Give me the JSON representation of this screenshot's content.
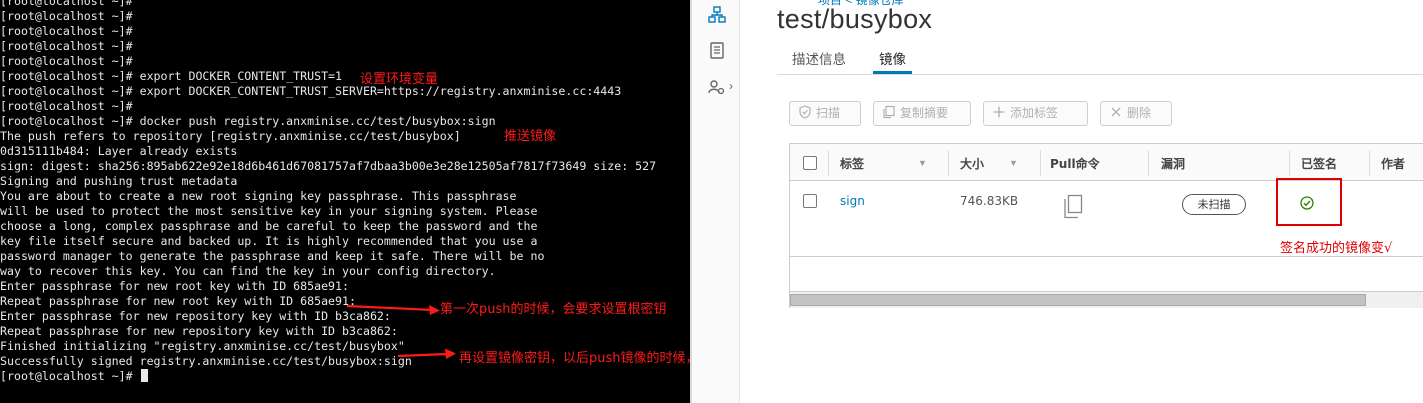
{
  "terminal": {
    "lines": [
      "[root@localhost ~]#",
      "[root@localhost ~]#",
      "[root@localhost ~]#",
      "[root@localhost ~]#",
      "[root@localhost ~]#",
      "[root@localhost ~]# export DOCKER_CONTENT_TRUST=1",
      "[root@localhost ~]# export DOCKER_CONTENT_TRUST_SERVER=https://registry.anxminise.cc:4443",
      "[root@localhost ~]#",
      "[root@localhost ~]# docker push registry.anxminise.cc/test/busybox:sign",
      "The push refers to repository [registry.anxminise.cc/test/busybox]",
      "0d315111b484: Layer already exists",
      "sign: digest: sha256:895ab622e92e18d6b461d67081757af7dbaa3b00e3e28e12505af7817f73649 size: 527",
      "Signing and pushing trust metadata",
      "You are about to create a new root signing key passphrase. This passphrase",
      "will be used to protect the most sensitive key in your signing system. Please",
      "choose a long, complex passphrase and be careful to keep the password and the",
      "key file itself secure and backed up. It is highly recommended that you use a",
      "password manager to generate the passphrase and keep it safe. There will be no",
      "way to recover this key. You can find the key in your config directory.",
      "Enter passphrase for new root key with ID 685ae91:",
      "Repeat passphrase for new root key with ID 685ae91:",
      "Enter passphrase for new repository key with ID b3ca862:",
      "Repeat passphrase for new repository key with ID b3ca862:",
      "Finished initializing \"registry.anxminise.cc/test/busybox\"",
      "Successfully signed registry.anxminise.cc/test/busybox:sign",
      "[root@localhost ~]#"
    ],
    "annotations": {
      "env": "设置环境变量",
      "push": "推送镜像",
      "root_key": "第一次push的时候，会要求设置根密钥",
      "repo_key": "再设置镜像密钥，以后push镜像的时候，要求输入此密钥"
    },
    "colors": {
      "background": "#000000",
      "text": "#e8e8e8",
      "annotation": "#ff1a1a"
    }
  },
  "harbor": {
    "breadcrumb": "项目 < 镜像仓库",
    "repo_title": "test/busybox",
    "tabs": [
      {
        "label": "描述信息",
        "active": false
      },
      {
        "label": "镜像",
        "active": true
      }
    ],
    "toolbar": {
      "scan": "扫描",
      "copy_digest": "复制摘要",
      "add_label": "添加标签",
      "delete": "删除"
    },
    "grid": {
      "columns": [
        "标签",
        "大小",
        "Pull命令",
        "漏洞",
        "已签名",
        "作者"
      ],
      "rows": [
        {
          "tag": "sign",
          "size": "746.83KB",
          "vuln_status": "未扫描",
          "signed": true
        }
      ],
      "signed_annotation": "签名成功的镜像变√",
      "horizontal_scroll_fraction": 0.9
    },
    "icons": [
      "repository-icon",
      "document-icon",
      "settings-icon",
      "chevron-right-icon",
      "shield-icon",
      "copy-icon",
      "plus-icon",
      "close-icon",
      "sort-icon",
      "check-circle-icon"
    ],
    "colors": {
      "accent": "#0079b8",
      "signed_ok": "#2f8400",
      "highlight": "#e00000"
    }
  }
}
